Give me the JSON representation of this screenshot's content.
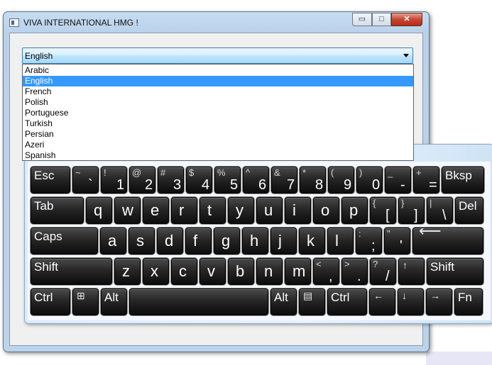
{
  "window": {
    "title": "VIVA INTERNATIONAL HMG !",
    "controls": {
      "minimize": "▭",
      "maximize": "□",
      "close": "✕"
    }
  },
  "language_select": {
    "selected": "English",
    "options": [
      "Arabic",
      "English",
      "French",
      "Polish",
      "Portuguese",
      "Turkish",
      "Persian",
      "Azeri",
      "Spanish"
    ],
    "selected_index": 1
  },
  "keyboard": {
    "row1": [
      {
        "type": "label",
        "label": "Esc"
      },
      {
        "type": "dual",
        "shift": "~",
        "base": "`"
      },
      {
        "type": "dual",
        "shift": "!",
        "base": "1"
      },
      {
        "type": "dual",
        "shift": "@",
        "base": "2"
      },
      {
        "type": "dual",
        "shift": "#",
        "base": "3"
      },
      {
        "type": "dual",
        "shift": "$",
        "base": "4"
      },
      {
        "type": "dual",
        "shift": "%",
        "base": "5"
      },
      {
        "type": "dual",
        "shift": "^",
        "base": "6"
      },
      {
        "type": "dual",
        "shift": "&",
        "base": "7"
      },
      {
        "type": "dual",
        "shift": "*",
        "base": "8"
      },
      {
        "type": "dual",
        "shift": "(",
        "base": "9"
      },
      {
        "type": "dual",
        "shift": ")",
        "base": "0"
      },
      {
        "type": "dual",
        "shift": "_",
        "base": "-"
      },
      {
        "type": "dual",
        "shift": "+",
        "base": "="
      },
      {
        "type": "label",
        "label": "Bksp"
      }
    ],
    "row2": [
      {
        "type": "label",
        "label": "Tab"
      },
      {
        "type": "char",
        "label": "q"
      },
      {
        "type": "char",
        "label": "w"
      },
      {
        "type": "char",
        "label": "e"
      },
      {
        "type": "char",
        "label": "r"
      },
      {
        "type": "char",
        "label": "t"
      },
      {
        "type": "char",
        "label": "y"
      },
      {
        "type": "char",
        "label": "u"
      },
      {
        "type": "char",
        "label": "i"
      },
      {
        "type": "char",
        "label": "o"
      },
      {
        "type": "char",
        "label": "p"
      },
      {
        "type": "dual",
        "shift": "{",
        "base": "["
      },
      {
        "type": "dual",
        "shift": "}",
        "base": "]"
      },
      {
        "type": "dual",
        "shift": "|",
        "base": "\\"
      },
      {
        "type": "label",
        "label": "Del"
      }
    ],
    "row3": [
      {
        "type": "label",
        "label": "Caps"
      },
      {
        "type": "char",
        "label": "a"
      },
      {
        "type": "char",
        "label": "s"
      },
      {
        "type": "char",
        "label": "d"
      },
      {
        "type": "char",
        "label": "f"
      },
      {
        "type": "char",
        "label": "g"
      },
      {
        "type": "char",
        "label": "h"
      },
      {
        "type": "char",
        "label": "j"
      },
      {
        "type": "char",
        "label": "k"
      },
      {
        "type": "char",
        "label": "l"
      },
      {
        "type": "dual",
        "shift": ":",
        "base": ";"
      },
      {
        "type": "dual",
        "shift": "\"",
        "base": "'"
      },
      {
        "type": "icon",
        "label": "⟵",
        "icon": "enter-icon"
      }
    ],
    "row4": [
      {
        "type": "label",
        "label": "Shift"
      },
      {
        "type": "char",
        "label": "z"
      },
      {
        "type": "char",
        "label": "x"
      },
      {
        "type": "char",
        "label": "c"
      },
      {
        "type": "char",
        "label": "v"
      },
      {
        "type": "char",
        "label": "b"
      },
      {
        "type": "char",
        "label": "n"
      },
      {
        "type": "char",
        "label": "m"
      },
      {
        "type": "dual",
        "shift": "<",
        "base": ","
      },
      {
        "type": "dual",
        "shift": ">",
        "base": "."
      },
      {
        "type": "dual",
        "shift": "?",
        "base": "/"
      },
      {
        "type": "icon",
        "label": "↑",
        "icon": "arrow-up-icon"
      },
      {
        "type": "label",
        "label": "Shift"
      }
    ],
    "row5": [
      {
        "type": "label",
        "label": "Ctrl"
      },
      {
        "type": "icon",
        "label": "⊞",
        "icon": "windows-logo-icon"
      },
      {
        "type": "label",
        "label": "Alt"
      },
      {
        "type": "label",
        "label": ""
      },
      {
        "type": "label",
        "label": "Alt"
      },
      {
        "type": "icon",
        "label": "▤",
        "icon": "menu-icon"
      },
      {
        "type": "label",
        "label": "Ctrl"
      },
      {
        "type": "icon",
        "label": "←",
        "icon": "arrow-left-icon"
      },
      {
        "type": "icon",
        "label": "↓",
        "icon": "arrow-down-icon"
      },
      {
        "type": "icon",
        "label": "→",
        "icon": "arrow-right-icon"
      },
      {
        "type": "label",
        "label": "Fn"
      }
    ]
  }
}
